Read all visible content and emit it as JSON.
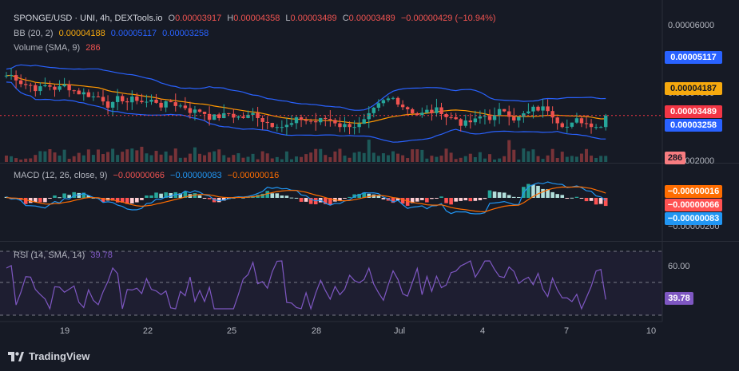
{
  "header": {
    "symbol": "SPONGE/USD · UNI, 4h, DEXTools.io",
    "o_label": "O",
    "o": "0.00003917",
    "h_label": "H",
    "h": "0.00004358",
    "l_label": "L",
    "l": "0.00003489",
    "c_label": "C",
    "c": "0.00003489",
    "change": "−0.00000429 (−10.94%)"
  },
  "bb": {
    "label": "BB (20, 2)",
    "basis": "0.00004188",
    "upper": "0.00005117",
    "lower": "0.00003258"
  },
  "volume": {
    "label": "Volume (SMA, 9)",
    "value": "286"
  },
  "macd": {
    "label": "MACD (12, 26, close, 9)",
    "hist": "−0.00000066",
    "macd": "−0.00000083",
    "signal": "−0.00000016"
  },
  "rsi": {
    "label": "RSI (14, SMA, 14)",
    "value": "39.78"
  },
  "price_axis": {
    "ticks": [
      "0.00006000",
      "0.00004000",
      "0.00002000"
    ]
  },
  "macd_axis": {
    "tick": "−0.00000200"
  },
  "rsi_axis": {
    "tick": "60.00"
  },
  "tags": {
    "bb_upper": "0.00005117",
    "bb_basis": "0.00004187",
    "price": "0.00003489",
    "bb_lower": "0.00003258",
    "volume": "286",
    "macd_signal": "−0.00000016",
    "macd_hist": "−0.00000066",
    "macd_line": "−0.00000083",
    "rsi": "39.78"
  },
  "x_axis": {
    "labels": [
      "19",
      "22",
      "25",
      "28",
      "Jul",
      "4",
      "7",
      "10"
    ]
  },
  "brand": {
    "name": "TradingView",
    "icon": "tradingview-logo-icon"
  },
  "colors": {
    "up": "#26a69a",
    "down": "#ef5350",
    "bb_band": "#2962ff",
    "bb_basis": "#ff9800",
    "macd_line": "#2196f3",
    "signal_line": "#ff6d00",
    "rsi_line": "#7e57c2",
    "rsi_zone": "#7e57c2",
    "price_tag": "#f23645",
    "bb_basis_tag": "#f6a90e",
    "bb_tag": "#2962ff",
    "volume_tag": "#f77c80"
  },
  "chart_data": [
    {
      "type": "candlestick",
      "title": "SPONGE/USD · UNI, 4h, DEXTools.io",
      "x_labels": [
        "19",
        "22",
        "25",
        "28",
        "Jul",
        "4",
        "7",
        "10"
      ],
      "ylim": [
        2e-05,
        6.8e-05
      ],
      "y_ticks": [
        6e-05,
        4e-05,
        2e-05
      ],
      "last_close": 3.489e-05,
      "bollinger": {
        "upper": 5.117e-05,
        "basis": 4.188e-05,
        "lower": 3.258e-05
      },
      "volume_last": 286
    },
    {
      "type": "line",
      "title": "MACD (12, 26, close, 9)",
      "series": [
        {
          "name": "MACD",
          "last": -8.3e-07
        },
        {
          "name": "Signal",
          "last": -1.6e-07
        },
        {
          "name": "Histogram",
          "last": -6.6e-07
        }
      ]
    },
    {
      "type": "line",
      "title": "RSI (14, SMA, 14)",
      "y_ticks": [
        60
      ],
      "series": [
        {
          "name": "RSI",
          "last": 39.78
        }
      ]
    }
  ]
}
